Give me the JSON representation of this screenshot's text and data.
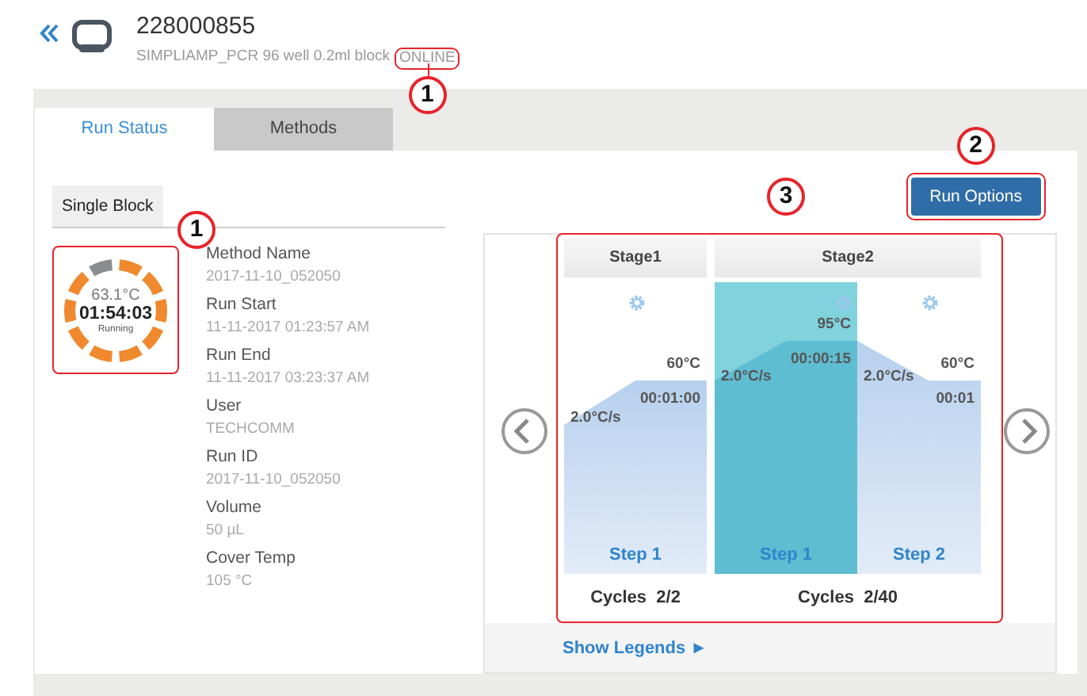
{
  "header": {
    "title": "228000855",
    "subtitle": "SIMPLIAMP_PCR 96 well 0.2ml block",
    "status": "ONLINE",
    "status_callout": "1"
  },
  "tabs": [
    {
      "label": "Run Status",
      "selected": true
    },
    {
      "label": "Methods",
      "selected": false
    }
  ],
  "block_tab": "Single Block",
  "timer": {
    "temperature": "63.1°C",
    "time": "01:54:03",
    "state": "Running",
    "level": 0.9,
    "callout": "1"
  },
  "details": [
    {
      "label": "Method Name",
      "value": "2017-11-10_052050"
    },
    {
      "label": "Run Start",
      "value": "11-11-2017 01:23:57 AM"
    },
    {
      "label": "Run End",
      "value": "11-11-2017 03:23:37 AM"
    },
    {
      "label": "User",
      "value": "TECHCOMM"
    },
    {
      "label": "Run ID",
      "value": "2017-11-10_052050"
    },
    {
      "label": "Volume",
      "value": "50 µL"
    },
    {
      "label": "Cover Temp",
      "value": "105 °C"
    }
  ],
  "run_options": {
    "label": "Run Options",
    "callout": "2"
  },
  "stages_callout": "3",
  "stages": [
    {
      "name": "Stage1",
      "cycles_label": "Cycles",
      "cycles": "2/2",
      "steps": [
        {
          "label": "Step 1",
          "temp": "60°C",
          "time": "00:01:00",
          "rate": "2.0°C/s",
          "selected": false
        }
      ]
    },
    {
      "name": "Stage2",
      "cycles_label": "Cycles",
      "cycles": "2/40",
      "steps": [
        {
          "label": "Step 1",
          "temp": "95°C",
          "time": "00:00:15",
          "rate": "2.0°C/s",
          "selected": true
        },
        {
          "label": "Step 2",
          "temp": "60°C",
          "time": "00:01",
          "rate": "2.0°C/s",
          "selected": false
        }
      ]
    }
  ],
  "show_legends": "Show Legends ►"
}
